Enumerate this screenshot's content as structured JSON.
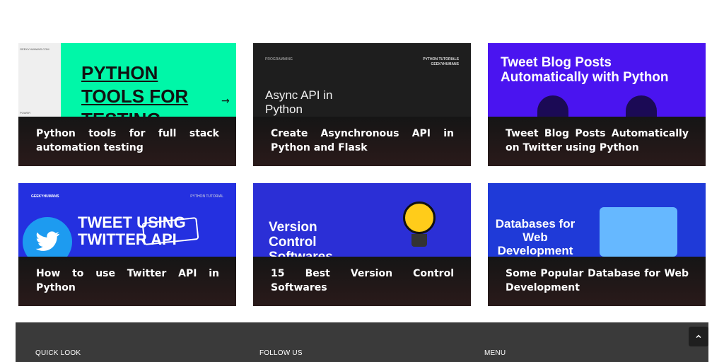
{
  "posts": [
    {
      "title": "Python tools for full stack automation testing",
      "thumb_text": "PYTHON TOOLS FOR TESTING",
      "thumb_tag_left": "GEEKYHUMANS.COM",
      "thumb_tag_bottom": "POWER",
      "thumb_arrow": "→"
    },
    {
      "title": "Create Asynchronous API in Python and Flask",
      "thumb_text": "Async API in Python",
      "thumb_tag_left": "PROGRAMMING",
      "thumb_tag_right_1": "PYTHON TUTORIALS",
      "thumb_tag_right_2": "GEEKYHUMANS"
    },
    {
      "title": "Tweet Blog Posts Automatically on Twitter using Python",
      "thumb_text": "Tweet Blog Posts Automatically with Python"
    },
    {
      "title": "How to use Twitter API in Python",
      "thumb_text": "TWEET USING TWITTER API",
      "thumb_tag_left": "GEEKYHUMANS",
      "thumb_tag_right": "PYTHON TUTORIAL"
    },
    {
      "title": "15 Best Version Control Softwares",
      "thumb_text": "Version Control Softwares"
    },
    {
      "title": "Some Popular Database for Web Development",
      "thumb_text": "Databases for Web Development"
    }
  ],
  "footer": {
    "quick_look": "QUICK LOOK",
    "follow_us": "FOLLOW US",
    "menu": "MENU"
  },
  "icons": {
    "scroll_top": "chevron-up-icon",
    "twitter": "twitter-bird-icon",
    "lightbulb": "lightbulb-icon"
  },
  "colors": {
    "caption_bg": "#1a1414",
    "footer_bg": "#3a3a3a",
    "thumb1": "#00f7a8",
    "thumb3": "#4a14f0"
  }
}
